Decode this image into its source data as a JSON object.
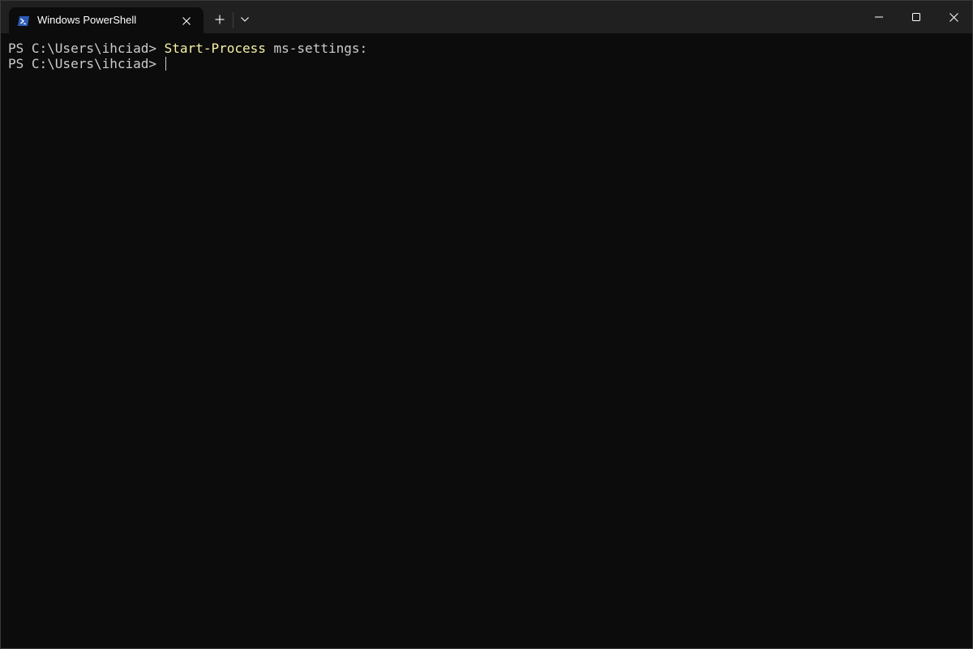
{
  "window": {
    "tab_title": "Windows PowerShell",
    "tab_icon": "powershell-icon",
    "caption_icons": [
      "minimize-icon",
      "maximize-icon",
      "close-icon"
    ],
    "new_tab_icon": "plus-icon",
    "dropdown_icon": "chevron-down-icon"
  },
  "terminal": {
    "lines": [
      {
        "prompt": "PS C:\\Users\\ihciad> ",
        "command": "Start-Process",
        "args": " ms-settings:"
      },
      {
        "prompt": "PS C:\\Users\\ihciad> ",
        "command": "",
        "args": ""
      }
    ]
  },
  "colors": {
    "background": "#0c0c0c",
    "titlebar": "#202020",
    "text": "#cccccc",
    "command": "#f9f1a5",
    "powershell_blue": "#2c5bb8"
  }
}
